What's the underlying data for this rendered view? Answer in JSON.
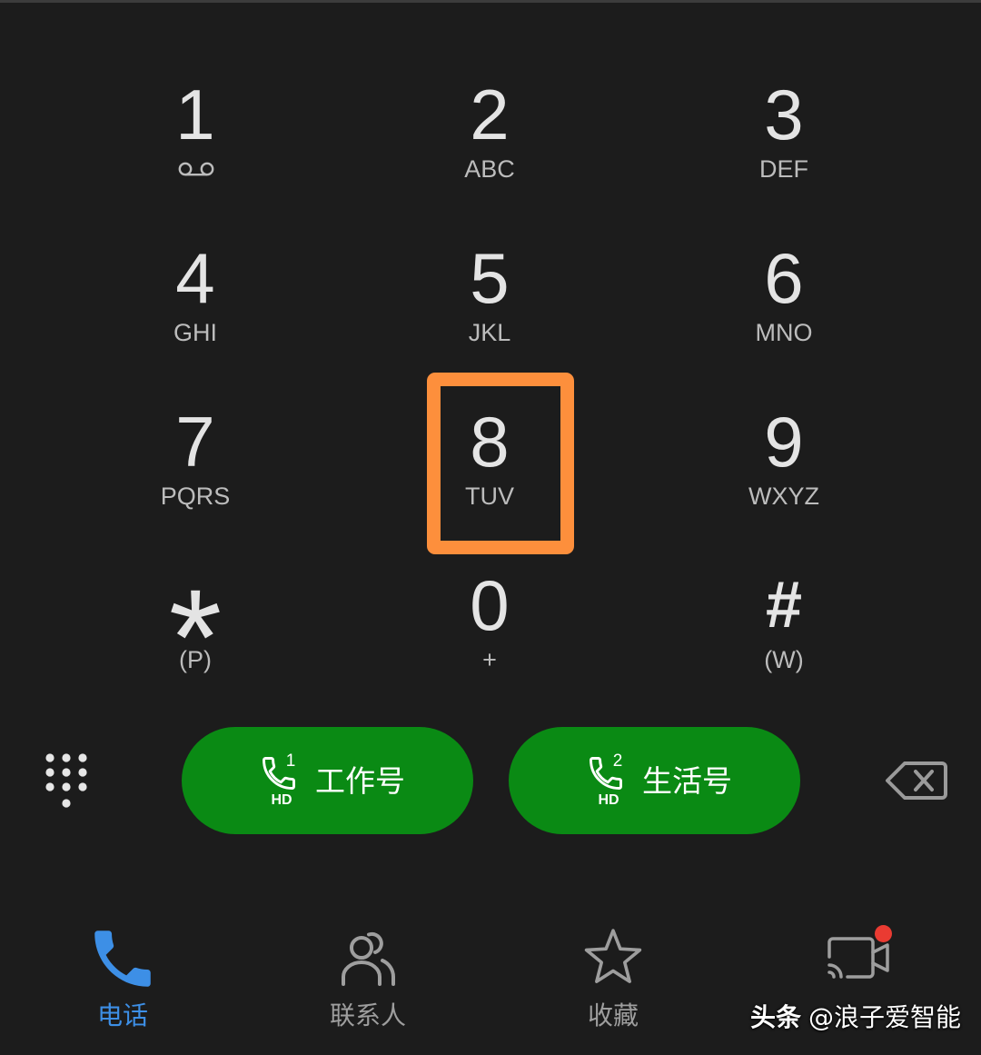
{
  "keypad": {
    "keys": [
      {
        "digit": "1",
        "sub_icon": "voicemail-icon"
      },
      {
        "digit": "2",
        "letters": "ABC"
      },
      {
        "digit": "3",
        "letters": "DEF"
      },
      {
        "digit": "4",
        "letters": "GHI"
      },
      {
        "digit": "5",
        "letters": "JKL"
      },
      {
        "digit": "6",
        "letters": "MNO"
      },
      {
        "digit": "7",
        "letters": "PQRS"
      },
      {
        "digit": "8",
        "letters": "TUV",
        "highlighted": true
      },
      {
        "digit": "9",
        "letters": "WXYZ"
      },
      {
        "digit": "*",
        "letters": "(P)"
      },
      {
        "digit": "0",
        "letters": "+"
      },
      {
        "digit": "#",
        "letters": "(W)"
      }
    ]
  },
  "actions": {
    "dialpad_toggle_icon": "dialpad-icon",
    "call_buttons": [
      {
        "icon": "phone-icon",
        "sim_slot": "1",
        "badge": "HD",
        "label": "工作号"
      },
      {
        "icon": "phone-icon",
        "sim_slot": "2",
        "badge": "HD",
        "label": "生活号"
      }
    ],
    "backspace_icon": "backspace-icon"
  },
  "nav": {
    "items": [
      {
        "icon": "phone-icon",
        "label": "电话",
        "active": true
      },
      {
        "icon": "contacts-icon",
        "label": "联系人",
        "active": false
      },
      {
        "icon": "star-icon",
        "label": "收藏",
        "active": false
      },
      {
        "icon": "video-call-icon",
        "active": false,
        "notification_dot": true
      }
    ]
  },
  "watermark": {
    "brand": "头条",
    "handle": "@浪子爱智能"
  },
  "colors": {
    "background": "#1c1c1c",
    "digit": "#e4e4e4",
    "letters": "#bcbcbc",
    "highlight": "#fd8f3c",
    "call_button": "#0a8a14",
    "nav_active": "#3d8fe6",
    "nav_inactive": "#9e9e9e",
    "badge": "#ea3b32",
    "icon_gray": "#9a9a9a"
  }
}
